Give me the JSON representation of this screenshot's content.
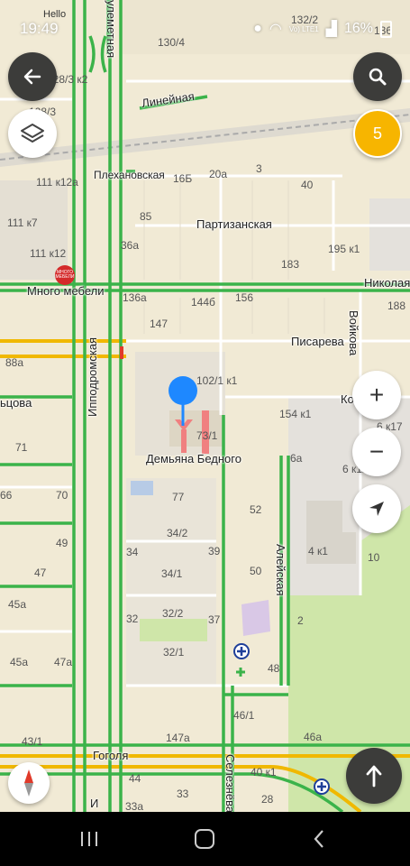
{
  "status_bar": {
    "time": "19:49",
    "notification": "Hello",
    "battery": "16%",
    "network": "Vo) LTE1"
  },
  "streets": {
    "lineynaya": "Линейная",
    "plekhanovskaya": "Плехановская",
    "partizanskaya": "Партизанская",
    "nikolaya": "Николая",
    "pisareva": "Писарева",
    "voykova": "Войкова",
    "ippodromskaya": "Ипподромская",
    "demyana_bednogo": "Демьяна Бедного",
    "kotsova": "ьцова",
    "kom": "Ко",
    "aleyskaya": "Алейская",
    "gogolya": "Гоголя",
    "seleznyova": "Селезнёва",
    "ulemetnaya": "улеметная",
    "ip_bottom": "И"
  },
  "place_labels": {
    "mnogo_mebeli": "Много мебели",
    "mnogo_mebeli_logo": "МНОГО МЕБЕЛИ"
  },
  "house_numbers": [
    "130/4",
    "128/3 к2",
    "128/3",
    "132/2",
    "136",
    "111 к12а",
    "111 к7",
    "111 к12",
    "16Б",
    "20а",
    "3",
    "40",
    "85",
    "36а",
    "195 к1",
    "183",
    "136а",
    "144б",
    "156",
    "188",
    "147",
    "88а",
    "102/1 к1",
    "154 к1",
    "6 к17",
    "73/1",
    "71",
    "6а",
    "6 к12",
    "66",
    "70",
    "77",
    "52",
    "49",
    "34/2",
    "39",
    "4 к1",
    "10",
    "47",
    "34",
    "34/1",
    "50",
    "45а",
    "32",
    "32/2",
    "37",
    "2",
    "45а",
    "47а",
    "32/1",
    "48",
    "46/1",
    "43/1",
    "147а",
    "46а",
    "44",
    "40 к1",
    "33а",
    "33",
    "28"
  ],
  "controls": {
    "back_icon": "arrow-left-icon",
    "search_icon": "search-icon",
    "layers_icon": "layers-icon",
    "traffic_score": "5",
    "zoom_in": "+",
    "zoom_out": "−",
    "compass_icon": "compass-icon",
    "locate_icon": "navigation-arrow-icon",
    "route_icon": "arrow-up-icon"
  },
  "colors": {
    "traffic_green": "#3bb34a",
    "traffic_yellow": "#f0b800",
    "traffic_red": "#e03a2a",
    "marker_blue": "#1e88ff",
    "park_green": "#cfe6a9",
    "badge_yellow": "#f7b500"
  }
}
